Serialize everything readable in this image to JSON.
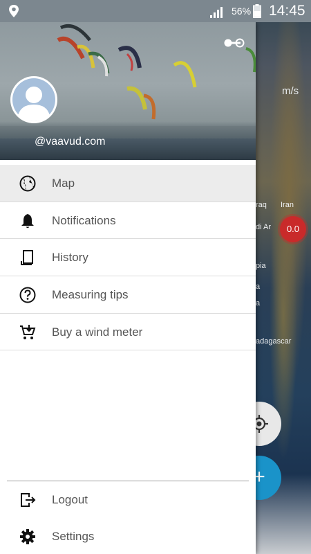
{
  "status_bar": {
    "battery_percent": "56%",
    "time": "14:45",
    "icons": [
      "location-icon",
      "signal-icon",
      "battery-icon"
    ]
  },
  "drawer": {
    "username": "@vaavud.com",
    "menu": [
      {
        "label": "Map",
        "icon": "globe-icon",
        "active": true
      },
      {
        "label": "Notifications",
        "icon": "bell-icon",
        "active": false
      },
      {
        "label": "History",
        "icon": "history-icon",
        "active": false
      },
      {
        "label": "Measuring tips",
        "icon": "question-icon",
        "active": false
      },
      {
        "label": "Buy a wind meter",
        "icon": "cart-icon",
        "active": false
      }
    ],
    "bottom": [
      {
        "label": "Logout",
        "icon": "logout-icon"
      },
      {
        "label": "Settings",
        "icon": "gear-icon"
      }
    ]
  },
  "map": {
    "unit": "m/s",
    "labels": [
      "raq",
      "Iran",
      "di Ar",
      "pia",
      "a",
      "a",
      "adagascar"
    ],
    "badge_value": "0.0"
  },
  "colors": {
    "status_bar": "#7c878f",
    "accent_fab": "#1a93c9",
    "badge": "#c92a2a",
    "active_item": "#ececec"
  }
}
